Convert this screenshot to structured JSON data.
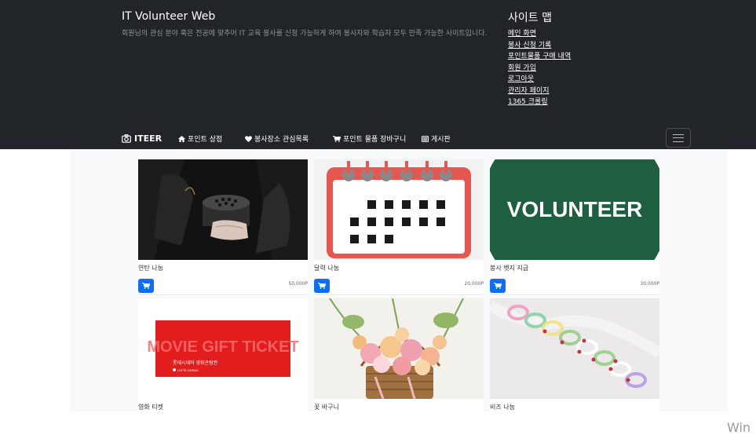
{
  "header": {
    "title": "IT Volunteer Web",
    "description": "회원님의 관심 분야 혹은 전공에 맞추어 IT 교육 봉사를 신청 가능하게 하여 봉사자와 학습자 모두 만족 가능한 사이트입니다.",
    "sitemap_title": "사이트 맵",
    "sitemap_links": [
      "메인 화면",
      "봉사 신청 기록",
      "포인트물품 구매 내역",
      "회원 가입",
      "로그아웃",
      "관리자 페이지",
      "1365 크롤링"
    ]
  },
  "navbar": {
    "brand": "ITEER",
    "items": [
      {
        "label": "포인트 상점",
        "icon": "home-icon"
      },
      {
        "label": "봉사장소 관심목록",
        "icon": "heart-icon"
      },
      {
        "label": "포인트 물품 장바구니",
        "icon": "cart-icon"
      },
      {
        "label": "게시판",
        "icon": "list-icon"
      }
    ]
  },
  "products": [
    {
      "name": "연탄 나눔",
      "price": "50,000P"
    },
    {
      "name": "달력 나눔",
      "price": "20,000P"
    },
    {
      "name": "봉사 뱃지 지급",
      "price": "30,000P",
      "image_text": "VOLUNTEER"
    },
    {
      "name": "영화 티켓",
      "image_text": "MOVIE GIFT TICKET",
      "image_subtext": "롯데시네마 영화관람권",
      "image_brand": "LOTTE CINEMA"
    },
    {
      "name": "꽃 바구니"
    },
    {
      "name": "비즈 나눔"
    }
  ],
  "colors": {
    "header_bg": "#212529",
    "content_bg": "#f8f9fa",
    "accent": "#0d6efd",
    "ticket_red": "#e11d1d",
    "badge_green": "#1e5f3f"
  },
  "watermark": "Win"
}
